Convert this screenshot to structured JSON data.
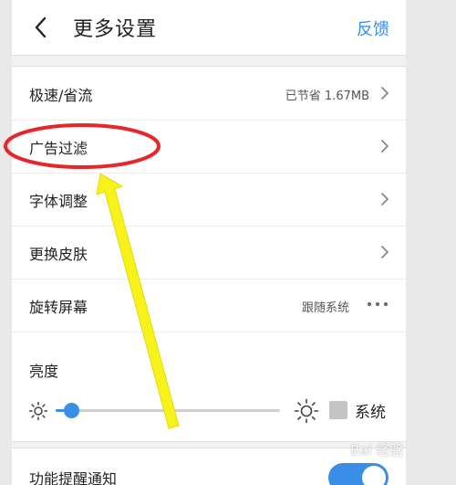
{
  "header": {
    "title": "更多设置",
    "feedback_label": "反馈"
  },
  "settings": {
    "rows": [
      {
        "label": "极速/省流",
        "value": "已节省 1.67MB",
        "control": "chevron-right-icon"
      },
      {
        "label": "广告过滤",
        "value": "",
        "control": "chevron-right-icon"
      },
      {
        "label": "字体调整",
        "value": "",
        "control": "chevron-right-icon"
      },
      {
        "label": "更换皮肤",
        "value": "",
        "control": "chevron-right-icon"
      },
      {
        "label": "旋转屏幕",
        "value": "跟随系统",
        "control": "more-dots-icon"
      }
    ],
    "brightness": {
      "label": "亮度",
      "level": 0.07,
      "follow_system_label": "系统",
      "follow_system_checked": false
    }
  },
  "notifications": {
    "label": "功能提醒通知",
    "enabled": true
  },
  "annotation": {
    "highlighted_item": "广告过滤",
    "circle_color": "#e8252b",
    "arrow_color": "#f6f21a"
  },
  "watermark": "Bai 经验",
  "colors": {
    "accent": "#3a8ee6"
  }
}
